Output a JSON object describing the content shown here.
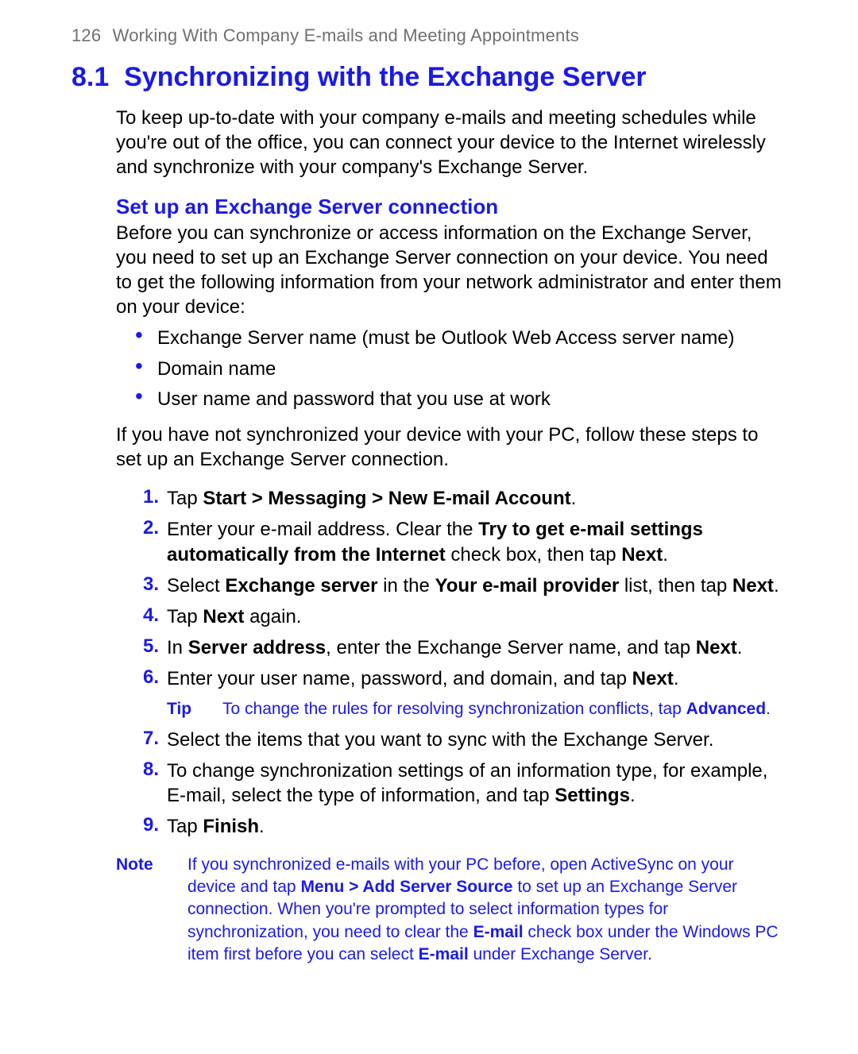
{
  "header": {
    "page_number": "126",
    "chapter_title": "Working With Company E-mails and Meeting Appointments"
  },
  "section": {
    "number": "8.1",
    "title": "Synchronizing with the Exchange Server",
    "intro": "To keep up-to-date with your company e-mails and meeting schedules while you're out of the office, you can connect your device to the Internet wirelessly and synchronize with your company's Exchange Server."
  },
  "sub": {
    "title": "Set up an Exchange Server connection",
    "lead": "Before you can synchronize or access information on the Exchange Server, you need to set up an Exchange Server connection on your device. You need to get the following information from your network administrator and enter them on your device:",
    "bullets": [
      "Exchange Server name (must be Outlook Web Access server name)",
      "Domain name",
      "User name and password that you use at work"
    ],
    "after_bullets": "If you have not synchronized your device with your PC, follow these steps to set up an Exchange Server connection."
  },
  "steps": {
    "s1_pre": "Tap ",
    "s1_bold": "Start > Messaging > New E-mail Account",
    "s1_post": ".",
    "s2_pre": "Enter your e-mail address. Clear the ",
    "s2_bold1": "Try to get e-mail settings automatically from the Internet",
    "s2_mid": " check box, then tap ",
    "s2_bold2": "Next",
    "s2_post": ".",
    "s3_pre": "Select ",
    "s3_bold1": "Exchange server",
    "s3_mid1": " in the ",
    "s3_bold2": "Your e-mail provider",
    "s3_mid2": " list, then tap ",
    "s3_bold3": "Next",
    "s3_post": ".",
    "s4_pre": "Tap ",
    "s4_bold": "Next",
    "s4_post": " again.",
    "s5_pre": "In ",
    "s5_bold1": "Server address",
    "s5_mid": ", enter the Exchange Server name, and tap ",
    "s5_bold2": "Next",
    "s5_post": ".",
    "s6_pre": "Enter your user name, password, and domain, and tap ",
    "s6_bold": "Next",
    "s6_post": ".",
    "s7": "Select the items that you want to sync with the Exchange Server.",
    "s8_pre": "To change synchronization settings of an information type, for example, E-mail, select the type of information, and tap ",
    "s8_bold": "Settings",
    "s8_post": ".",
    "s9_pre": "Tap ",
    "s9_bold": "Finish",
    "s9_post": "."
  },
  "tip": {
    "label": "Tip",
    "text_pre": "To change the rules for resolving synchronization conflicts, tap ",
    "text_bold": "Advanced",
    "text_post": "."
  },
  "note": {
    "label": "Note",
    "p1": "If you synchronized e-mails with your PC before, open ActiveSync on your device and tap ",
    "b1": "Menu > Add Server Source",
    "p2": " to set up an Exchange Server connection. When you're prompted to select information types for synchronization, you need to clear the ",
    "b2": "E-mail",
    "p3": " check box under the Windows PC item first before you can select ",
    "b3": "E-mail",
    "p4": " under Exchange Server."
  },
  "nums": {
    "n1": "1.",
    "n2": "2.",
    "n3": "3.",
    "n4": "4.",
    "n5": "5.",
    "n6": "6.",
    "n7": "7.",
    "n8": "8.",
    "n9": "9."
  },
  "dot": "•"
}
